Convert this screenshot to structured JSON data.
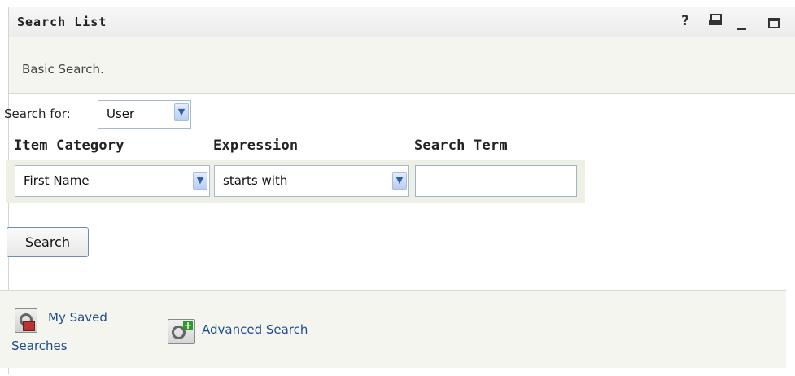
{
  "window": {
    "title": "Search List",
    "controls": {
      "help": "?"
    }
  },
  "subtitle": "Basic Search.",
  "search_for": {
    "label": "Search for:",
    "selected": "User"
  },
  "headers": {
    "item_category": "Item Category",
    "expression": "Expression",
    "search_term": "Search Term"
  },
  "row": {
    "item_category": "First Name",
    "expression": "starts with",
    "search_term": ""
  },
  "search_button": "Search",
  "footer": {
    "saved_searches_line1": "My Saved",
    "saved_searches_line2": "Searches",
    "advanced_search": "Advanced Search"
  },
  "icons": [
    "help-icon",
    "print-icon",
    "minimize-icon",
    "maximize-icon",
    "dropdown-arrow-icon",
    "saved-searches-icon",
    "advanced-search-icon"
  ],
  "colors": {
    "link": "#1f4b8f",
    "select_arrow": "#2d5fb0",
    "panel_bg": "#f5f5ef"
  }
}
